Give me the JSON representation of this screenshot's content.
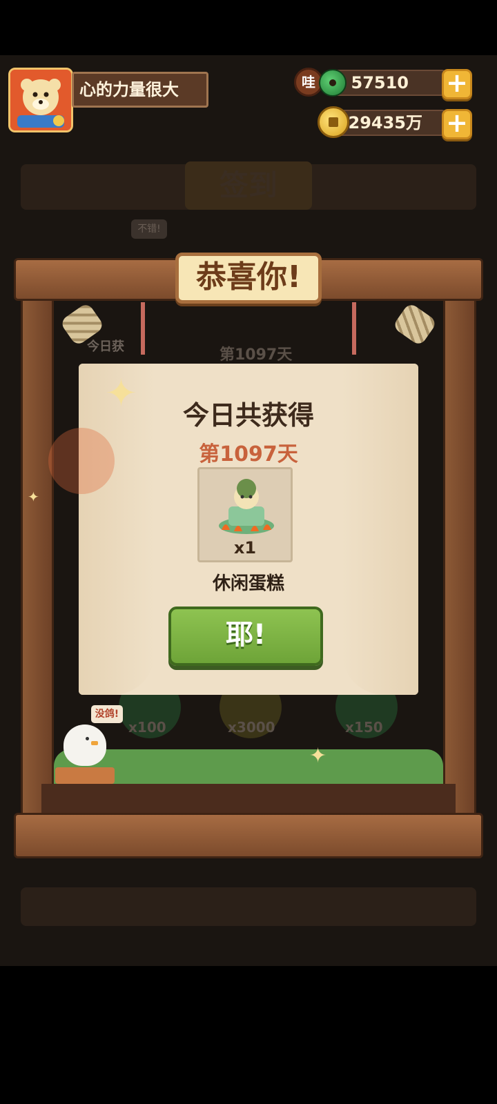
{
  "player": {
    "name": "心的力量很大"
  },
  "resources": {
    "jade": {
      "value": "57510",
      "icon_label": "哇"
    },
    "coins": {
      "value": "29435万"
    }
  },
  "background": {
    "sign_in_title": "签到",
    "not_bad_bubble": "不错!",
    "today_label": "今日获",
    "day_label": "第1097天",
    "rewards": [
      "x100",
      "x3000",
      "x150"
    ],
    "chick_bubble": "没鸽!"
  },
  "popup": {
    "plaque": "恭喜你!",
    "title": "今日共获得",
    "day": "第1097天",
    "item": {
      "count": "x1",
      "name": "休闲蛋糕"
    },
    "confirm_button": "耶!"
  },
  "colors": {
    "accent_green": "#7bb143",
    "day_red": "#c8623c",
    "wood": "#8d5a36",
    "gold": "#f0b636"
  },
  "icons": [
    "avatar-bear-icon",
    "jade-icon",
    "coin-icon",
    "plus-icon",
    "sparkle-icon",
    "chick-icon",
    "item-cake-icon"
  ]
}
